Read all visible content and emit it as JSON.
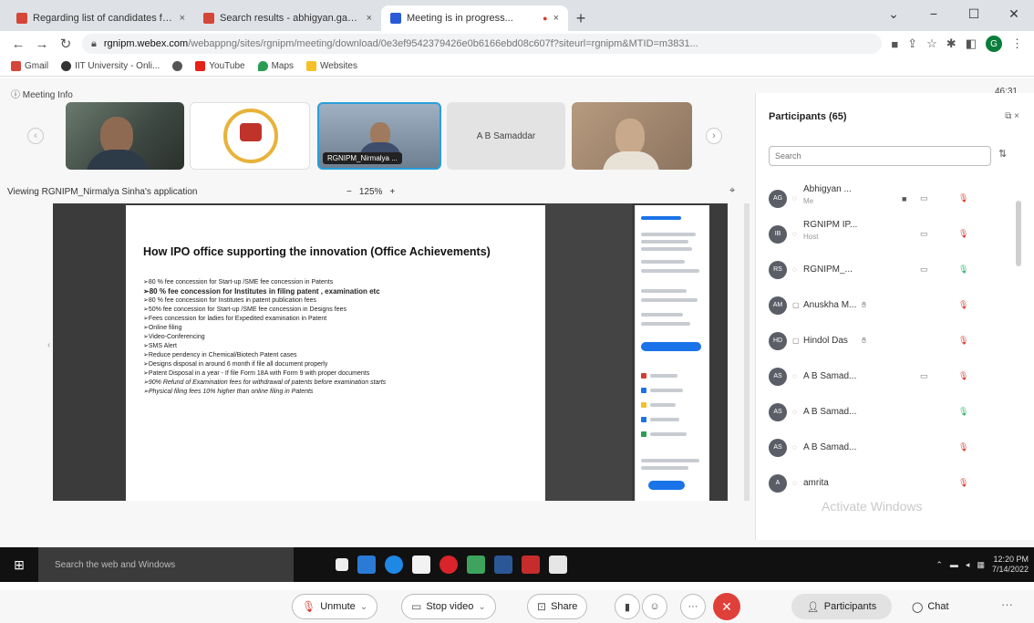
{
  "tabs": [
    {
      "title": "Regarding list of candidates for...",
      "favicon_color": "#d44638",
      "active": false
    },
    {
      "title": "Search results - abhigyan.gang...",
      "favicon_color": "#d44638",
      "active": false
    },
    {
      "title": "Meeting is in progress...",
      "favicon_color": "#2a5bd7",
      "active": true
    }
  ],
  "address": {
    "host": "rgnipm.webex.com",
    "path": "/webappng/sites/rgnipm/meeting/download/0e3ef9542379426e0b6166ebd08c607f?siteurl=rgnipm&MTID=m3831...",
    "secure": true
  },
  "bookmarks": [
    {
      "label": "Gmail",
      "color": "#d44638"
    },
    {
      "label": "IIT University - Onli...",
      "color": "#333333"
    },
    {
      "label": "",
      "color": "#555555"
    },
    {
      "label": "YouTube",
      "color": "#e62117"
    },
    {
      "label": "Maps",
      "color": "#2a9d52"
    },
    {
      "label": "Websites",
      "color": "#f6c026"
    }
  ],
  "profile_letter": "G",
  "meeting": {
    "info_label": "Meeting Info",
    "timer": "46:31",
    "viewing": "Viewing RGNIPM_Nirmalya Sinha's application",
    "zoom": "125%"
  },
  "videos": [
    {
      "type": "person"
    },
    {
      "type": "logo"
    },
    {
      "type": "person-active",
      "label": "RGNIPM_Nirmalya ..."
    },
    {
      "type": "name",
      "label": "A B Samaddar"
    },
    {
      "type": "person-elder"
    }
  ],
  "slide": {
    "title": "How IPO office supporting the innovation (Office Achievements)",
    "bullets": [
      {
        "text": "➢80 % fee concession for Start-up /SME fee concession in Patents",
        "style": "normal"
      },
      {
        "text": "➢80 % fee concession for Institutes in filing patent , examination etc",
        "style": "bold"
      },
      {
        "text": "➢80 % fee concession for Institutes in patent publication fees",
        "style": "normal"
      },
      {
        "text": "➢50% fee concession for Start-up /SME fee concession in Designs fees",
        "style": "normal"
      },
      {
        "text": "➢Fees concession for ladies for Expedited examination in Patent",
        "style": "normal"
      },
      {
        "text": "➢Online filing",
        "style": "normal"
      },
      {
        "text": "➢Video-Conferencing",
        "style": "normal"
      },
      {
        "text": "➢SMS Alert",
        "style": "normal"
      },
      {
        "text": "➢Reduce pendency in Chemical/Biotech Patent cases",
        "style": "normal"
      },
      {
        "text": "➢Designs disposal in around 6 month if file all document properly",
        "style": "normal"
      },
      {
        "text": "➢Patent Disposal in a year - If file Form 18A with Form 9 with proper documents",
        "style": "normal"
      },
      {
        "text": "➢90% Refund of Examination fees for withdrawal of patents before examination starts",
        "style": "italic"
      },
      {
        "text": "➢Physical filing fees 10% higher than online filing in Patents",
        "style": "italic"
      }
    ]
  },
  "participants": {
    "header": "Participants (65)",
    "search_placeholder": "Search",
    "list": [
      {
        "initials": "AG",
        "name": "Abhigyan ...",
        "sub": "Me",
        "share": true,
        "cam": true,
        "mic": "muted",
        "hand": false
      },
      {
        "initials": "IB",
        "name": "RGNIPM IP...",
        "sub": "Host",
        "share": false,
        "cam": true,
        "mic": "muted",
        "hand": false
      },
      {
        "initials": "RS",
        "name": "RGNIPM_...",
        "sub": "",
        "share": false,
        "cam": true,
        "mic": "on",
        "hand": false
      },
      {
        "initials": "AM",
        "name": "Anuskha M...",
        "sub": "",
        "share": false,
        "cam": false,
        "mic": "muted",
        "hand": true
      },
      {
        "initials": "HD",
        "name": "Hindol Das",
        "sub": "",
        "share": false,
        "cam": false,
        "mic": "muted",
        "hand": true
      },
      {
        "initials": "AS",
        "name": "A B Samad...",
        "sub": "",
        "share": false,
        "cam": true,
        "mic": "muted",
        "hand": false
      },
      {
        "initials": "AS",
        "name": "A B Samad...",
        "sub": "",
        "share": false,
        "cam": false,
        "mic": "on",
        "hand": false
      },
      {
        "initials": "AS",
        "name": "A B Samad...",
        "sub": "",
        "share": false,
        "cam": false,
        "mic": "muted",
        "hand": false
      },
      {
        "initials": "A",
        "name": "amrita",
        "sub": "",
        "share": false,
        "cam": false,
        "mic": "muted",
        "hand": false
      }
    ]
  },
  "watermark": "Activate Windows",
  "controls": {
    "unmute": "Unmute",
    "stop_video": "Stop video",
    "share": "Share",
    "participants": "Participants",
    "chat": "Chat"
  },
  "taskbar": {
    "search_placeholder": "Search the web and Windows",
    "time": "12:20 PM",
    "date": "7/14/2022"
  }
}
